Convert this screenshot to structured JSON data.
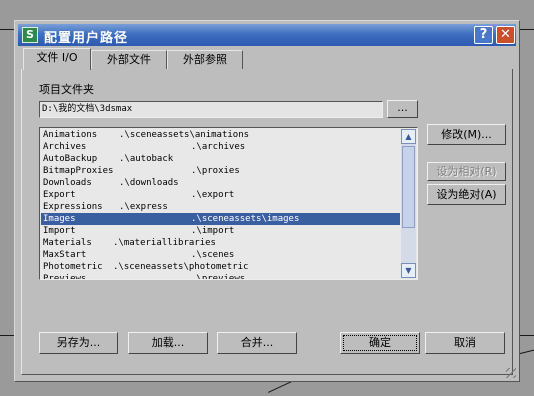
{
  "window": {
    "title": "配置用户路径",
    "help": "?",
    "close": "✕"
  },
  "tabs": [
    {
      "label": "文件 I/O",
      "active": true
    },
    {
      "label": "外部文件",
      "active": false
    },
    {
      "label": "外部参照",
      "active": false
    }
  ],
  "project": {
    "label": "项目文件夹",
    "path": "D:\\我的文档\\3dsmax",
    "browse": "..."
  },
  "paths": [
    {
      "name": "Animations",
      "path": ".\\sceneassets\\animations"
    },
    {
      "name": "Archives",
      "path": ".\\archives"
    },
    {
      "name": "AutoBackup",
      "path": ".\\autoback"
    },
    {
      "name": "BitmapProxies",
      "path": ".\\proxies"
    },
    {
      "name": "Downloads",
      "path": ".\\downloads"
    },
    {
      "name": "Export",
      "path": ".\\export"
    },
    {
      "name": "Expressions",
      "path": ".\\express"
    },
    {
      "name": "Images",
      "path": ".\\sceneassets\\images",
      "selected": true
    },
    {
      "name": "Import",
      "path": ".\\import"
    },
    {
      "name": "Materials",
      "path": ".\\materiallibraries"
    },
    {
      "name": "MaxStart",
      "path": ".\\scenes"
    },
    {
      "name": "Photometric",
      "path": ".\\sceneassets\\photometric"
    },
    {
      "name": "Previews",
      "path": ".\\previews"
    }
  ],
  "side_buttons": {
    "modify": "修改(M)...",
    "make_relative": "设为相对(R)",
    "make_absolute": "设为绝对(A)"
  },
  "bottom_buttons": {
    "save_as": "另存为...",
    "load": "加载...",
    "merge": "合并...",
    "ok": "确定",
    "cancel": "取消"
  },
  "colors": {
    "title_bar": "#2d5ab0",
    "selection": "#3a5fa0",
    "dialog": "#bdbdbd"
  }
}
